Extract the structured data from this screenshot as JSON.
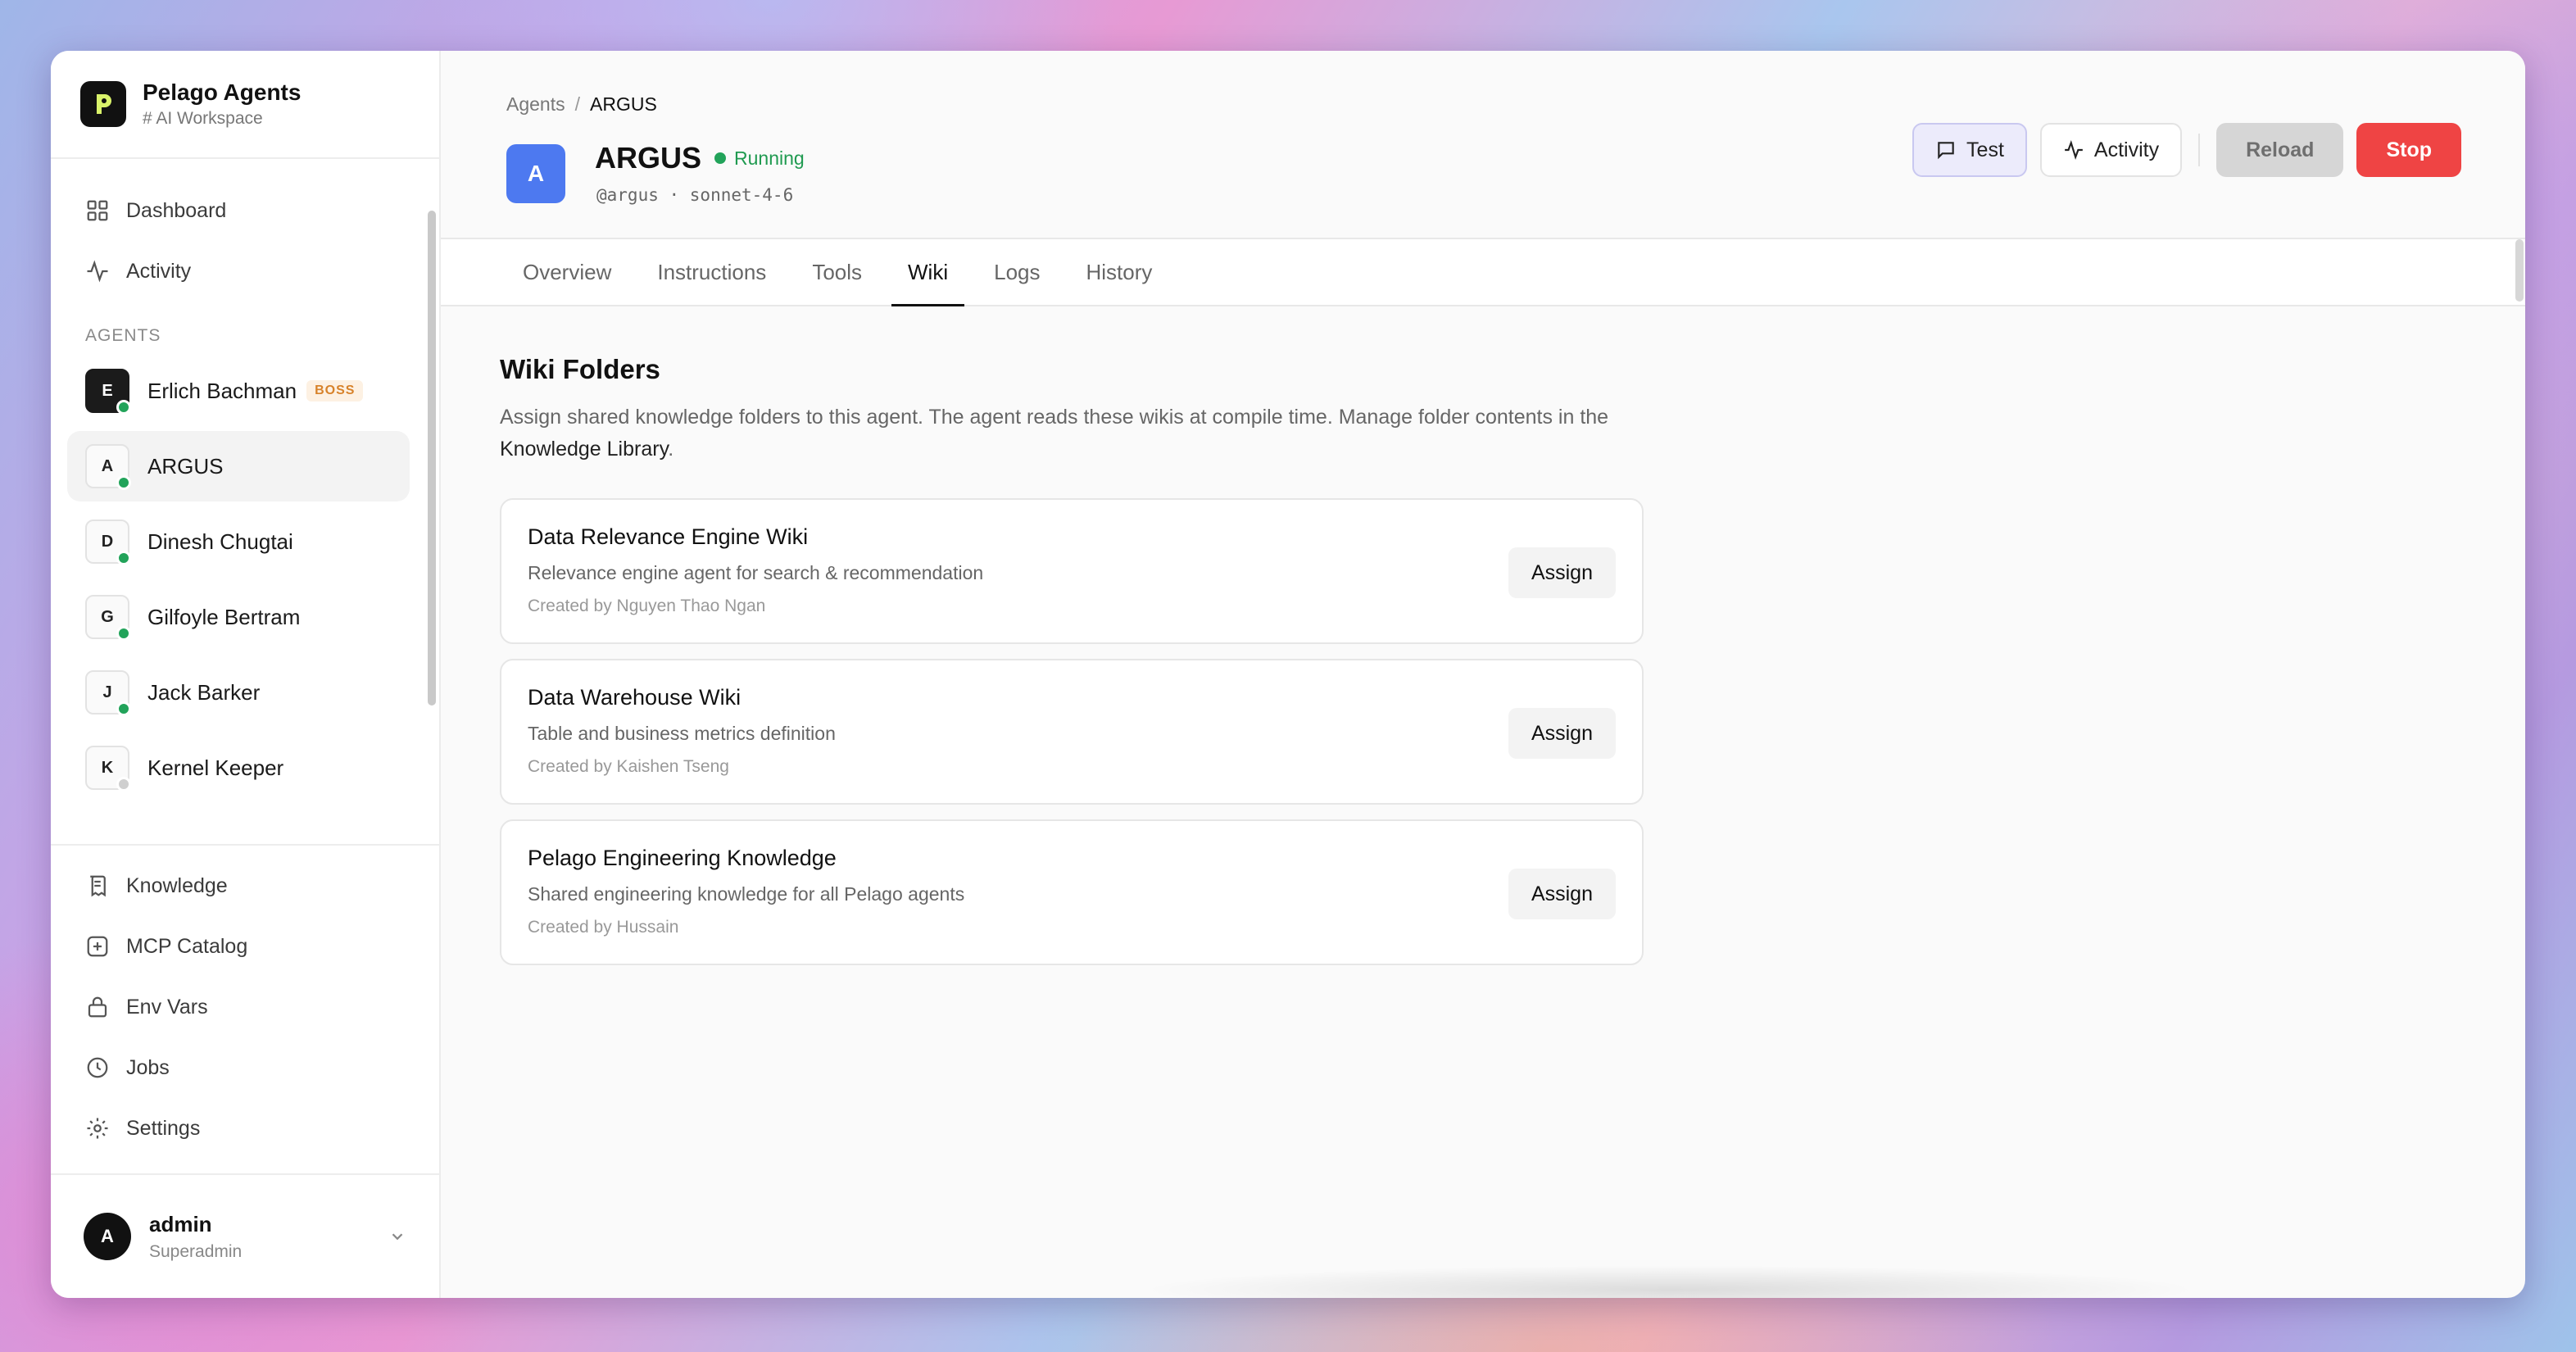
{
  "brand": {
    "title": "Pelago Agents",
    "subtitle": "# AI Workspace"
  },
  "nav_top": [
    {
      "label": "Dashboard",
      "icon": "dashboard-icon"
    },
    {
      "label": "Activity",
      "icon": "activity-icon"
    }
  ],
  "agents_section_label": "AGENTS",
  "agents": [
    {
      "initial": "E",
      "name": "Erlich Bachman",
      "badge": "BOSS",
      "status": "online"
    },
    {
      "initial": "A",
      "name": "ARGUS",
      "status": "online",
      "active": true
    },
    {
      "initial": "D",
      "name": "Dinesh Chugtai",
      "status": "online"
    },
    {
      "initial": "G",
      "name": "Gilfoyle Bertram",
      "status": "online"
    },
    {
      "initial": "J",
      "name": "Jack Barker",
      "status": "online"
    },
    {
      "initial": "K",
      "name": "Kernel Keeper",
      "status": "offline"
    }
  ],
  "nav_bottom": [
    {
      "label": "Knowledge",
      "icon": "book-icon"
    },
    {
      "label": "MCP Catalog",
      "icon": "plus-square-icon"
    },
    {
      "label": "Env Vars",
      "icon": "lock-icon"
    },
    {
      "label": "Jobs",
      "icon": "clock-icon"
    },
    {
      "label": "Settings",
      "icon": "gear-icon"
    }
  ],
  "user": {
    "initial": "A",
    "name": "admin",
    "role": "Superadmin"
  },
  "breadcrumb": {
    "parent": "Agents",
    "sep": "/",
    "current": "ARGUS"
  },
  "agent": {
    "initial": "A",
    "name": "ARGUS",
    "status": "Running",
    "meta": "@argus · sonnet-4-6",
    "avatar_color": "#4d79f0"
  },
  "actions": {
    "test": "Test",
    "activity": "Activity",
    "reload": "Reload",
    "stop": "Stop"
  },
  "tabs": [
    "Overview",
    "Instructions",
    "Tools",
    "Wiki",
    "Logs",
    "History"
  ],
  "active_tab": "Wiki",
  "wiki": {
    "title": "Wiki Folders",
    "description": "Assign shared knowledge folders to this agent. The agent reads these wikis at compile time. Manage folder contents in the",
    "link": "Knowledge Library",
    "period": ".",
    "folders": [
      {
        "title": "Data Relevance Engine Wiki",
        "description": "Relevance engine agent for search & recommendation",
        "created": "Created by Nguyen Thao Ngan",
        "action": "Assign"
      },
      {
        "title": "Data Warehouse Wiki",
        "description": "Table and business metrics definition",
        "created": "Created by Kaishen Tseng",
        "action": "Assign"
      },
      {
        "title": "Pelago Engineering Knowledge",
        "description": "Shared engineering knowledge for all Pelago agents",
        "created": "Created by Hussain",
        "action": "Assign"
      }
    ]
  },
  "colors": {
    "accent_running": "#22a35a",
    "stop": "#ef4444",
    "agent_avatar": "#4d79f0",
    "boss_badge": "#d7822a"
  }
}
